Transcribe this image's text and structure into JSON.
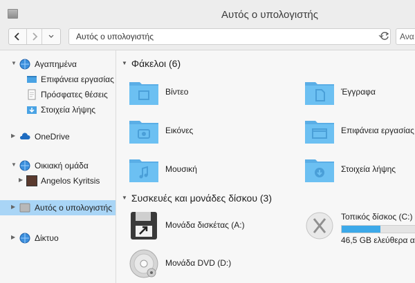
{
  "window": {
    "title": "Αυτός ο υπολογιστής"
  },
  "address_bar": {
    "path": "Αυτός ο υπολογιστής"
  },
  "search": {
    "placeholder": "Ανα"
  },
  "sidebar": {
    "favorites": {
      "label": "Αγαπημένα",
      "items": [
        {
          "label": "Επιφάνεια εργασίας"
        },
        {
          "label": "Πρόσφατες θέσεις"
        },
        {
          "label": "Στοιχεία λήψης"
        }
      ]
    },
    "onedrive": {
      "label": "OneDrive"
    },
    "homegroup": {
      "label": "Οικιακή ομάδα",
      "items": [
        {
          "label": "Angelos Kyritsis"
        }
      ]
    },
    "this_pc": {
      "label": "Αυτός ο υπολογιστής"
    },
    "network": {
      "label": "Δίκτυο"
    }
  },
  "main": {
    "folders_header": "Φάκελοι (6)",
    "folders": [
      {
        "label": "Βίντεο",
        "icon": "video-folder-icon"
      },
      {
        "label": "Έγγραφα",
        "icon": "documents-folder-icon"
      },
      {
        "label": "Εικόνες",
        "icon": "pictures-folder-icon"
      },
      {
        "label": "Επιφάνεια εργασίας",
        "icon": "desktop-folder-icon"
      },
      {
        "label": "Μουσική",
        "icon": "music-folder-icon"
      },
      {
        "label": "Στοιχεία λήψης",
        "icon": "downloads-folder-icon"
      }
    ],
    "devices_header": "Συσκευές και μονάδες δίσκου (3)",
    "devices": [
      {
        "label": "Μονάδα δισκέτας (A:)",
        "icon": "floppy-drive-icon"
      },
      {
        "label": "Τοπικός δίσκος (C:)",
        "icon": "local-disk-icon",
        "used_fraction": 0.47,
        "free_text": "46,5 GB ελεύθερα απ"
      },
      {
        "label": "Μονάδα DVD (D:)",
        "icon": "dvd-drive-icon"
      }
    ]
  },
  "colors": {
    "selected_bg": "#a9d5f6",
    "folder_blue": "#63b7ec",
    "capacity_bar": "#3da9e9"
  }
}
